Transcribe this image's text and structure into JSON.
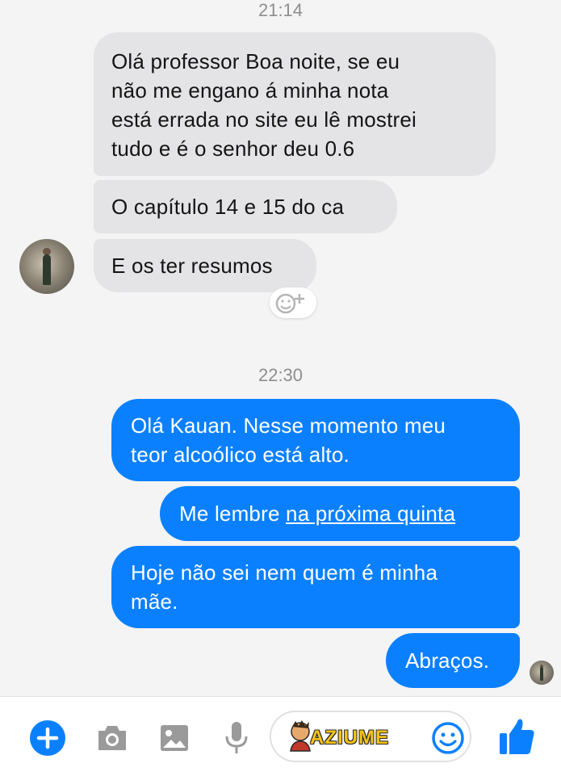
{
  "conversation": {
    "timestamp_1": "21:14",
    "timestamp_2": "22:30",
    "incoming": [
      {
        "lines": [
          "Olá professor Boa noite, se eu",
          "não me engano á minha nota",
          "está errada no site eu lê mostrei",
          "tudo e é o senhor deu 0.6"
        ]
      },
      {
        "lines": [
          "O capítulo 14 e 15 do ca"
        ]
      },
      {
        "lines": [
          "E os ter resumos"
        ]
      }
    ],
    "outgoing": [
      {
        "lines": [
          "Olá Kauan. Nesse momento meu",
          "teor alcoólico está alto."
        ]
      },
      {
        "prefix": "Me lembre ",
        "link": "na próxima quinta"
      },
      {
        "lines": [
          "Hoje não sei nem quem é minha",
          "mãe."
        ]
      },
      {
        "lines": [
          "Abraços."
        ]
      }
    ]
  },
  "reaction": {
    "icon": "add-reaction-icon"
  },
  "toolbar": {
    "icons": [
      "plus-icon",
      "camera-icon",
      "image-icon",
      "microphone-icon",
      "emoji-icon",
      "thumbs-up-icon"
    ],
    "accent_color": "#0b80ff"
  },
  "watermark": {
    "text": "AZIUME"
  },
  "colors": {
    "outgoing_bubble": "#0b80ff",
    "incoming_bubble": "#e4e4e6",
    "background": "#f4f4f4"
  }
}
